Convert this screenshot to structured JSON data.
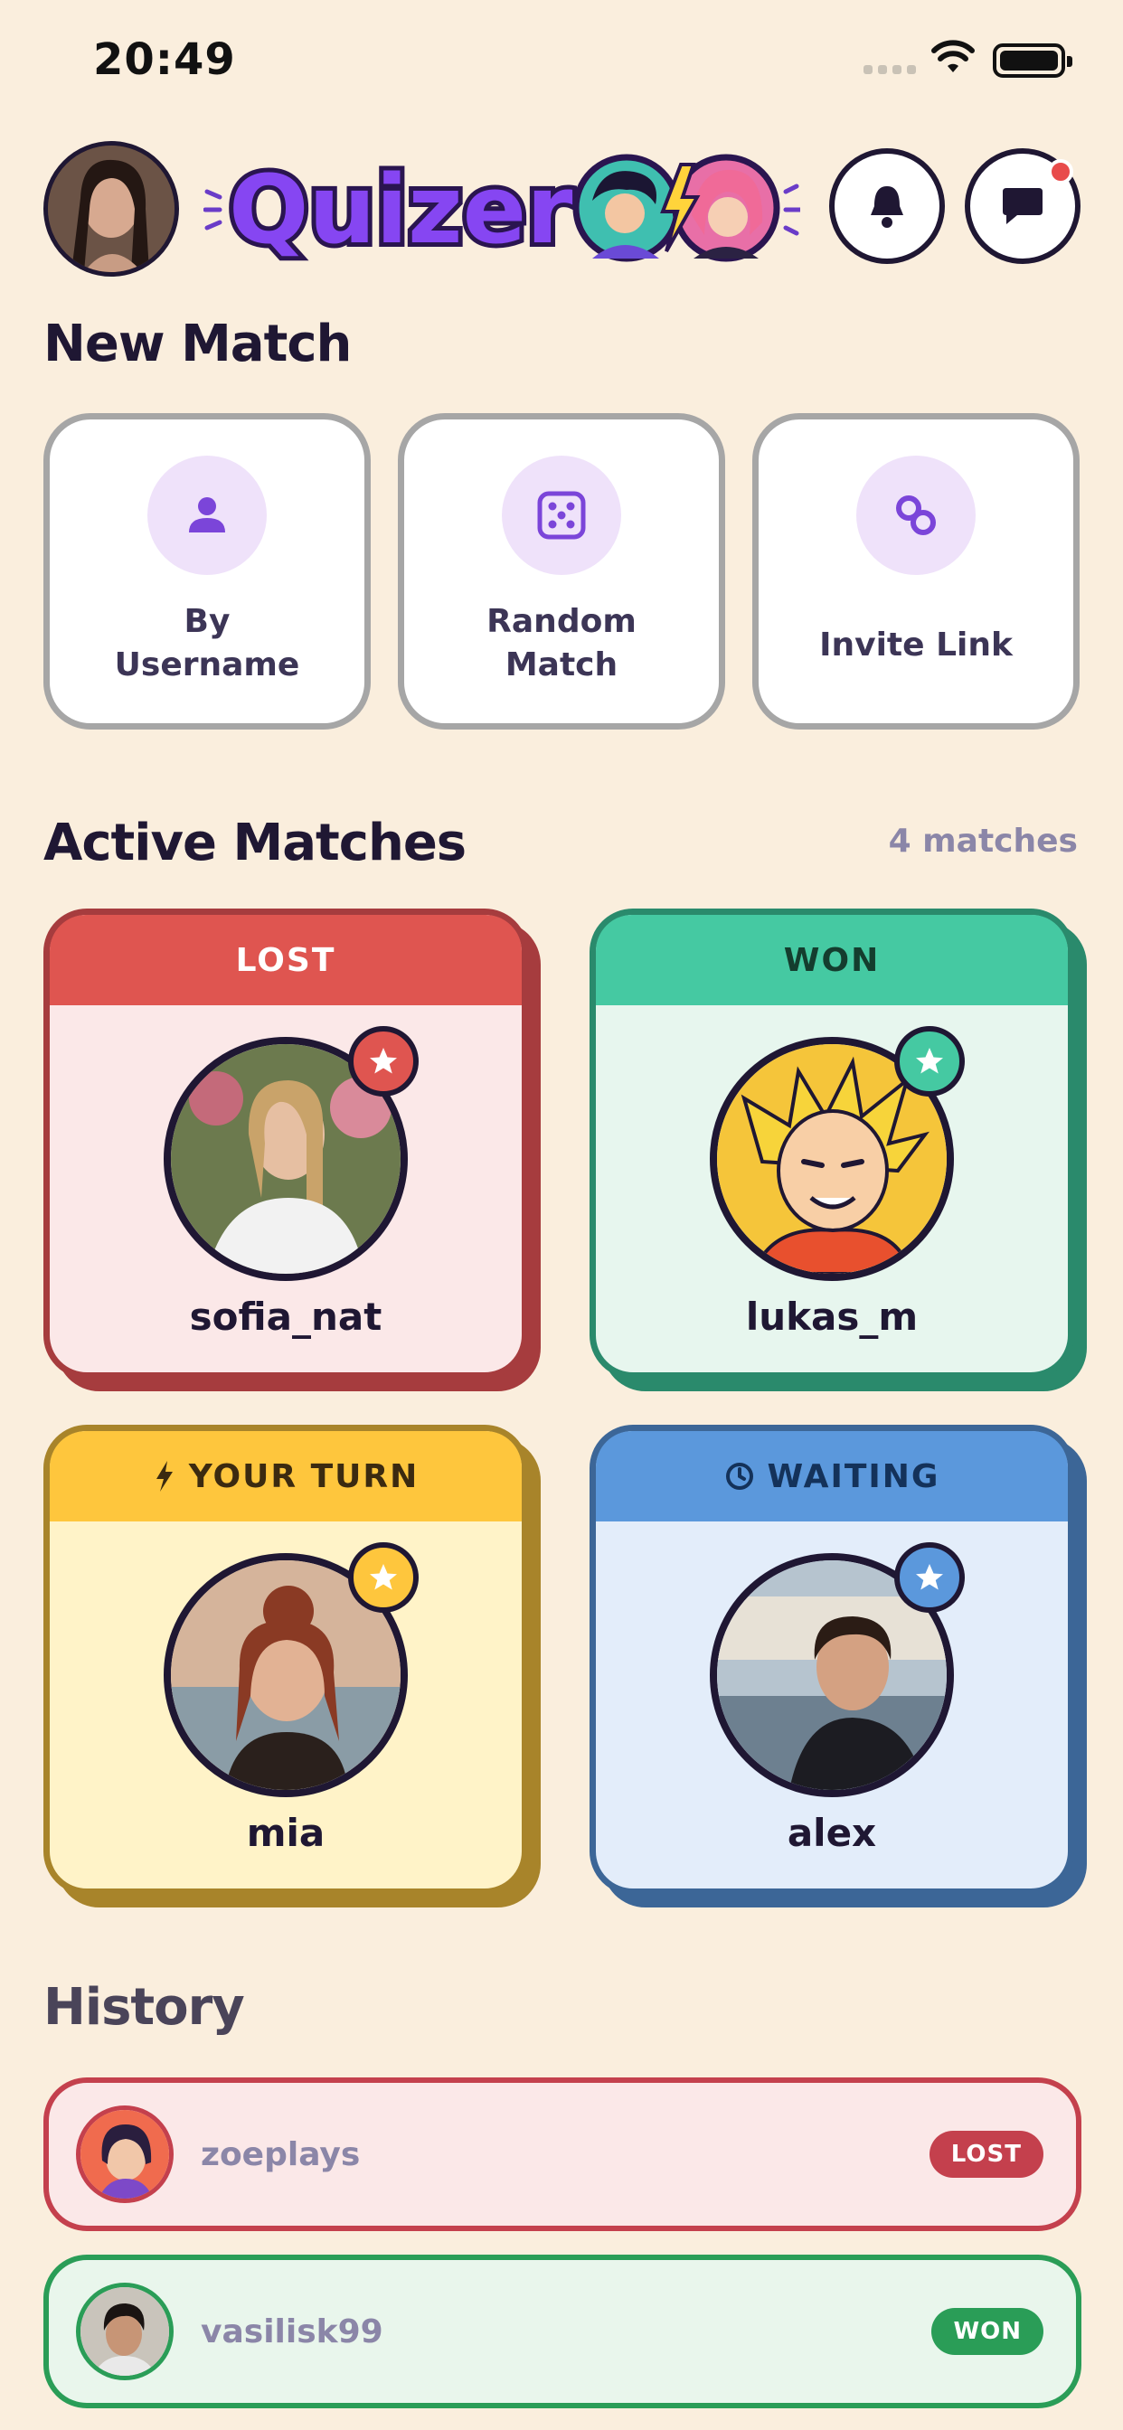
{
  "status_bar": {
    "time": "20:49"
  },
  "header": {
    "logo_text": "Quizer"
  },
  "new_match": {
    "title": "New Match",
    "options": [
      {
        "label": "By\nUsername",
        "icon": "person-icon"
      },
      {
        "label": "Random\nMatch",
        "icon": "dice-icon"
      },
      {
        "label": "Invite Link",
        "icon": "link-icon"
      }
    ]
  },
  "active_matches": {
    "title": "Active Matches",
    "count": "4 matches",
    "items": [
      {
        "status": "LOST",
        "name": "sofia_nat",
        "head_color": "#df5550",
        "body_color": "#fbe8e8",
        "border_color": "#a63c3e",
        "star_color": "#df5550"
      },
      {
        "status": "WON",
        "name": "lukas_m",
        "head_color": "#45c9a2",
        "body_color": "#e7f6ee",
        "border_color": "#2a8a6c",
        "star_color": "#45c9a2"
      },
      {
        "status": "YOUR TURN",
        "name": "mia",
        "head_color": "#fec63d",
        "body_color": "#fff3c8",
        "border_color": "#a8842a",
        "star_color": "#fec63d"
      },
      {
        "status": "WAITING",
        "name": "alex",
        "head_color": "#5b98dc",
        "body_color": "#e3edfa",
        "border_color": "#3c6697",
        "star_color": "#5b98dc"
      }
    ]
  },
  "history": {
    "title": "History",
    "items": [
      {
        "name": "zoeplays",
        "result": "LOST",
        "bg": "#fbe8e8",
        "border": "#c4404d",
        "badge": "#c4404d"
      },
      {
        "name": "vasilisk99",
        "result": "WON",
        "bg": "#e9f6ec",
        "border": "#2a9d57",
        "badge": "#2a9d57"
      }
    ]
  }
}
